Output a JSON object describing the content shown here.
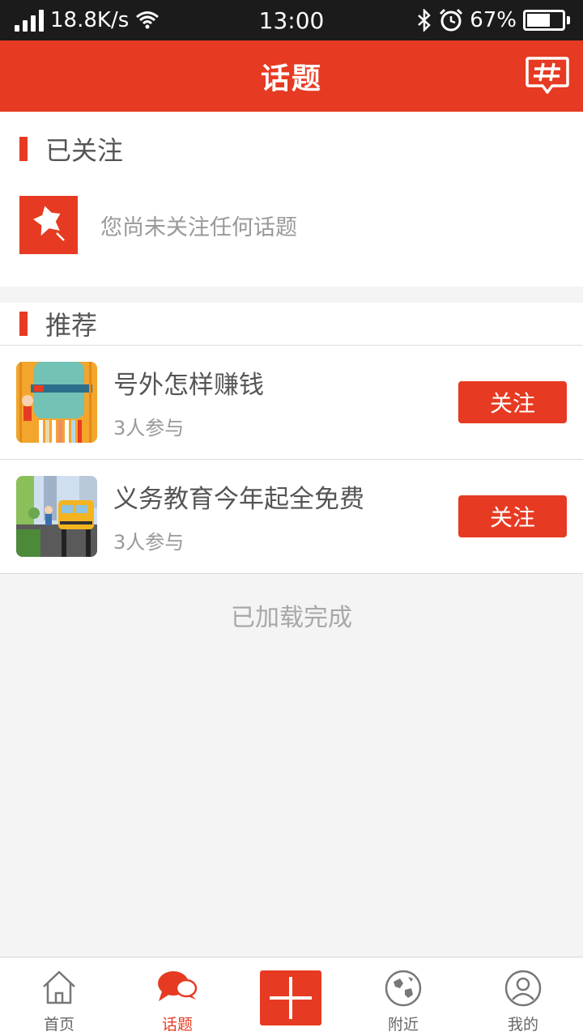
{
  "status_bar": {
    "net_speed": "18.8K/s",
    "time": "13:00",
    "battery_text": "67%",
    "battery_level": 0.67
  },
  "header": {
    "title": "话题",
    "action_icon": "hashtag-comment-icon"
  },
  "followed": {
    "heading": "已关注",
    "empty_message": "您尚未关注任何话题",
    "empty_icon": "broken-star-icon"
  },
  "recommend": {
    "heading": "推荐",
    "topics": [
      {
        "title": "号外怎样赚钱",
        "participants": "3人参与",
        "follow_label": "关注"
      },
      {
        "title": "义务教育今年起全免费",
        "participants": "3人参与",
        "follow_label": "关注"
      }
    ]
  },
  "list_status": "已加载完成",
  "bottom_nav": {
    "items": [
      {
        "label": "首页",
        "icon": "home-icon"
      },
      {
        "label": "话题",
        "icon": "chat-bubbles-icon"
      },
      {
        "label": "",
        "icon": "plus-icon"
      },
      {
        "label": "附近",
        "icon": "globe-icon"
      },
      {
        "label": "我的",
        "icon": "user-icon"
      }
    ],
    "active_index": 1
  },
  "colors": {
    "accent": "#e63b22",
    "status_bar": "#1b1b1b",
    "background": "#f4f4f4"
  }
}
